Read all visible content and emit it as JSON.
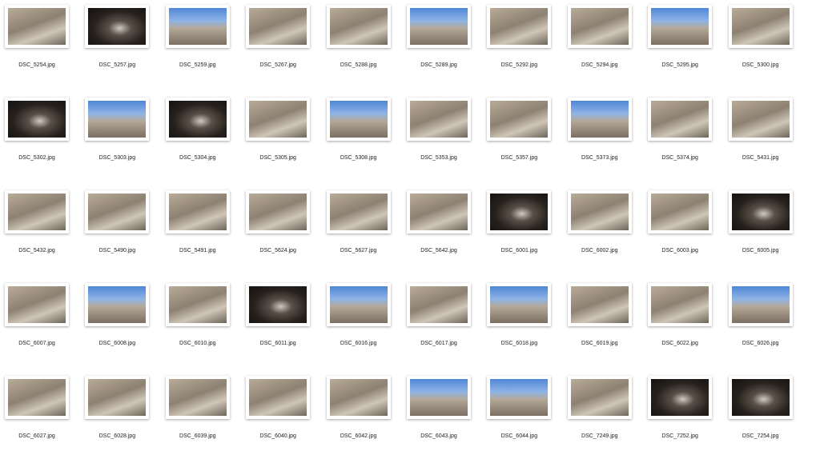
{
  "items": [
    {
      "name": "DSC_5254.jpg",
      "tone": "stone"
    },
    {
      "name": "DSC_5257.jpg",
      "tone": "dark"
    },
    {
      "name": "DSC_5259.jpg",
      "tone": "sky"
    },
    {
      "name": "DSC_5267.jpg",
      "tone": "stone"
    },
    {
      "name": "DSC_5288.jpg",
      "tone": "stone"
    },
    {
      "name": "DSC_5289.jpg",
      "tone": "sky"
    },
    {
      "name": "DSC_5292.jpg",
      "tone": "stone"
    },
    {
      "name": "DSC_5294.jpg",
      "tone": "stone"
    },
    {
      "name": "DSC_5295.jpg",
      "tone": "sky"
    },
    {
      "name": "DSC_5300.jpg",
      "tone": "stone"
    },
    {
      "name": "DSC_5302.jpg",
      "tone": "dark"
    },
    {
      "name": "DSC_5303.jpg",
      "tone": "sky"
    },
    {
      "name": "DSC_5304.jpg",
      "tone": "dark"
    },
    {
      "name": "DSC_5305.jpg",
      "tone": "stone"
    },
    {
      "name": "DSC_5308.jpg",
      "tone": "sky"
    },
    {
      "name": "DSC_5353.jpg",
      "tone": "stone"
    },
    {
      "name": "DSC_5357.jpg",
      "tone": "stone"
    },
    {
      "name": "DSC_5373.jpg",
      "tone": "sky"
    },
    {
      "name": "DSC_5374.jpg",
      "tone": "stone"
    },
    {
      "name": "DSC_5431.jpg",
      "tone": "stone"
    },
    {
      "name": "DSC_5432.jpg",
      "tone": "stone"
    },
    {
      "name": "DSC_5490.jpg",
      "tone": "stone"
    },
    {
      "name": "DSC_5491.jpg",
      "tone": "stone"
    },
    {
      "name": "DSC_5624.jpg",
      "tone": "stone"
    },
    {
      "name": "DSC_5627.jpg",
      "tone": "stone"
    },
    {
      "name": "DSC_5642.jpg",
      "tone": "stone"
    },
    {
      "name": "DSC_6001.jpg",
      "tone": "dark"
    },
    {
      "name": "DSC_6002.jpg",
      "tone": "stone"
    },
    {
      "name": "DSC_6003.jpg",
      "tone": "stone"
    },
    {
      "name": "DSC_6005.jpg",
      "tone": "dark"
    },
    {
      "name": "DSC_6007.jpg",
      "tone": "stone"
    },
    {
      "name": "DSC_6008.jpg",
      "tone": "sky"
    },
    {
      "name": "DSC_6010.jpg",
      "tone": "stone"
    },
    {
      "name": "DSC_6011.jpg",
      "tone": "dark"
    },
    {
      "name": "DSC_6016.jpg",
      "tone": "sky"
    },
    {
      "name": "DSC_6017.jpg",
      "tone": "stone"
    },
    {
      "name": "DSC_6018.jpg",
      "tone": "sky"
    },
    {
      "name": "DSC_6019.jpg",
      "tone": "stone"
    },
    {
      "name": "DSC_6022.jpg",
      "tone": "stone"
    },
    {
      "name": "DSC_6026.jpg",
      "tone": "sky"
    },
    {
      "name": "DSC_6027.jpg",
      "tone": "stone"
    },
    {
      "name": "DSC_6028.jpg",
      "tone": "stone"
    },
    {
      "name": "DSC_6039.jpg",
      "tone": "stone"
    },
    {
      "name": "DSC_6040.jpg",
      "tone": "stone"
    },
    {
      "name": "DSC_6042.jpg",
      "tone": "stone"
    },
    {
      "name": "DSC_6043.jpg",
      "tone": "sky"
    },
    {
      "name": "DSC_6044.jpg",
      "tone": "sky"
    },
    {
      "name": "DSC_7249.jpg",
      "tone": "stone"
    },
    {
      "name": "DSC_7252.jpg",
      "tone": "dark"
    },
    {
      "name": "DSC_7254.jpg",
      "tone": "dark"
    }
  ]
}
